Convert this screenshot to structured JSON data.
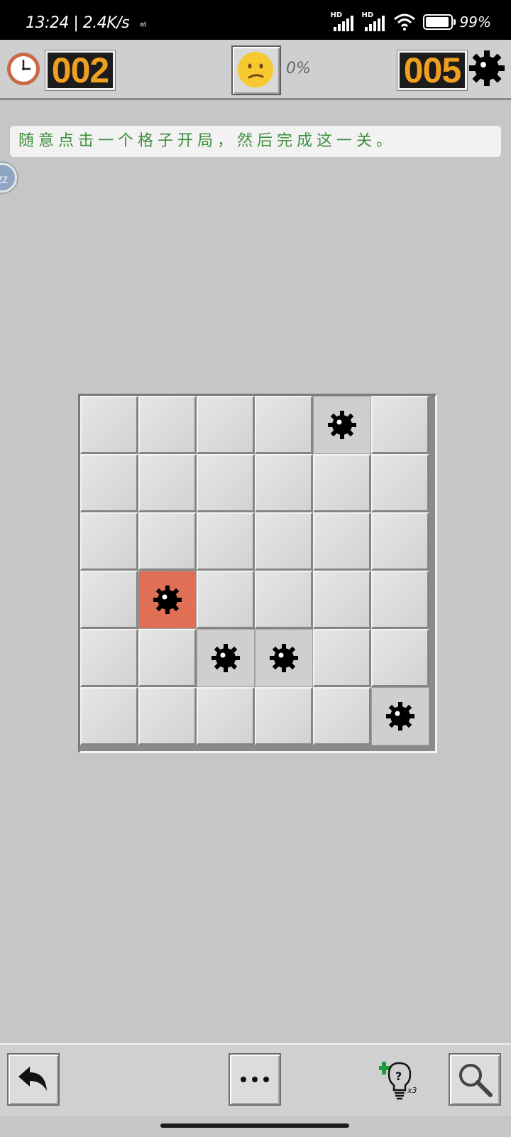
{
  "status_bar": {
    "time": "13:24",
    "net_speed": "| 2.4K/s",
    "extra": "㎧",
    "signal1_label": "HD",
    "signal2_label": "HD",
    "battery": "99%"
  },
  "game_bar": {
    "timer": "002",
    "progress": "0%",
    "mines_left": "005",
    "face": "confused-face-icon"
  },
  "hint_text": "随意点击一个格子开局，然后完成这一关。",
  "bubble_label": "ZZ",
  "board": {
    "rows": 6,
    "cols": 6,
    "cells": [
      [
        "covered",
        "covered",
        "covered",
        "covered",
        "mine",
        "covered"
      ],
      [
        "covered",
        "covered",
        "covered",
        "covered",
        "covered",
        "covered"
      ],
      [
        "covered",
        "covered",
        "covered",
        "covered",
        "covered",
        "covered"
      ],
      [
        "covered",
        "exploded",
        "covered",
        "covered",
        "covered",
        "covered"
      ],
      [
        "covered",
        "covered",
        "mine",
        "mine",
        "covered",
        "covered"
      ],
      [
        "covered",
        "covered",
        "covered",
        "covered",
        "covered",
        "mine"
      ]
    ]
  },
  "bottom_bar": {
    "undo_icon": "undo-arrow-icon",
    "more_icon": "more-dots-icon",
    "hint_icon": "lightbulb-hint-icon",
    "hint_count": "x3",
    "zoom_icon": "magnifier-icon"
  },
  "colors": {
    "counter_digits": "#f0a020",
    "exploded_cell": "#e07055",
    "hint_text": "#3f8f3f"
  }
}
